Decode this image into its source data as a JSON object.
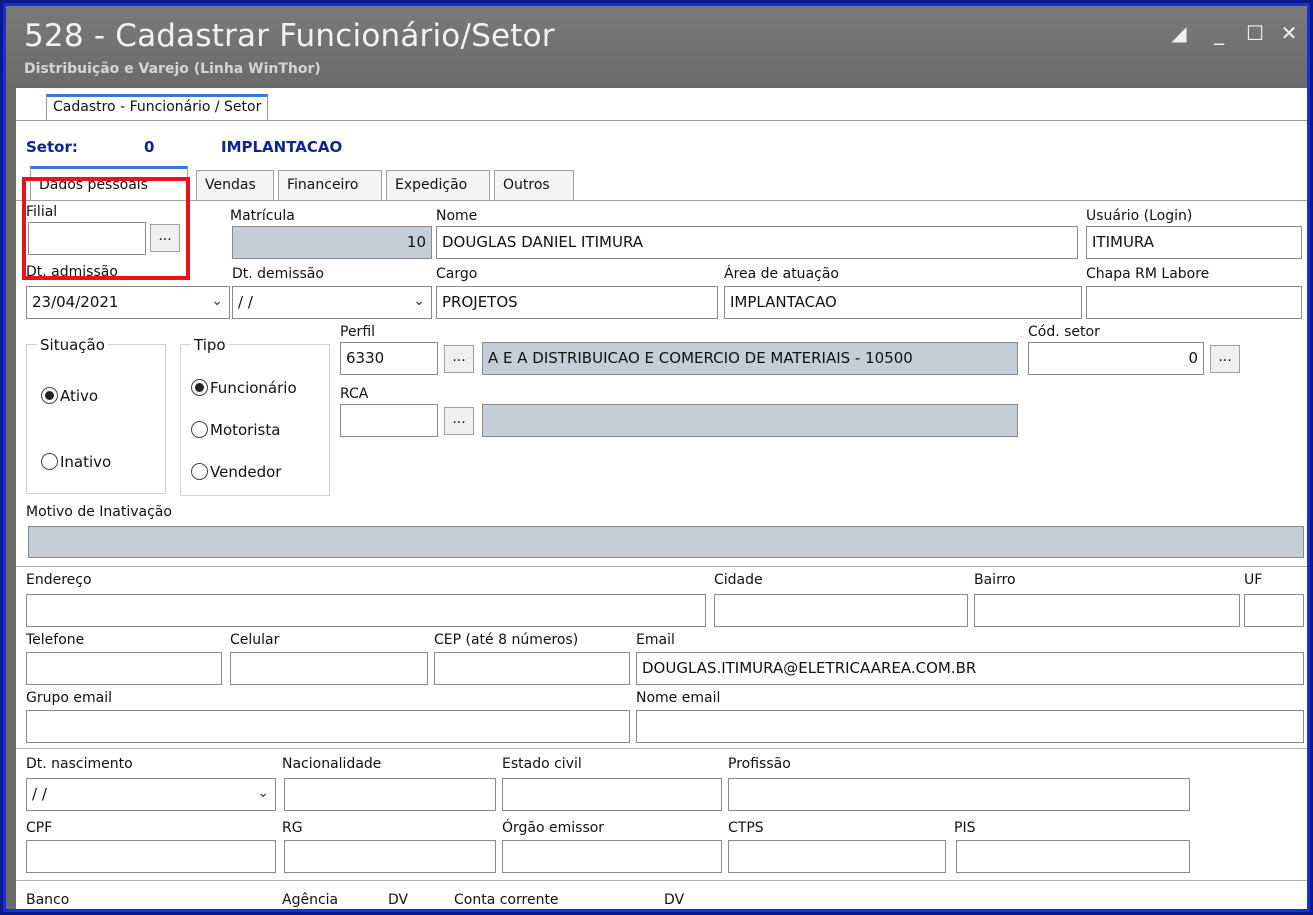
{
  "window": {
    "title": "528 - Cadastrar Funcionário/Setor",
    "subtitle": "Distribuição e Varejo (Linha WinThor)"
  },
  "main_tab": "Cadastro - Funcionário / Setor",
  "setor": {
    "label": "Setor:",
    "code": "0",
    "name": "IMPLANTACAO"
  },
  "tabs": [
    "Dados pessoais",
    "Vendas",
    "Financeiro",
    "Expedição",
    "Outros"
  ],
  "form": {
    "filial": {
      "label": "Filial",
      "value": ""
    },
    "matricula": {
      "label": "Matrícula",
      "value": "10"
    },
    "nome": {
      "label": "Nome",
      "value": "DOUGLAS DANIEL ITIMURA"
    },
    "usuario": {
      "label": "Usuário (Login)",
      "value": "ITIMURA"
    },
    "dt_admissao": {
      "label": "Dt. admissão",
      "value": "23/04/2021"
    },
    "dt_demissao": {
      "label": "Dt.  demissão",
      "value": "/ /"
    },
    "cargo": {
      "label": "Cargo",
      "value": "PROJETOS"
    },
    "area": {
      "label": "Área de atuação",
      "value": "IMPLANTACAO"
    },
    "chapa": {
      "label": "Chapa RM Labore",
      "value": ""
    },
    "situacao": {
      "label": "Situação",
      "options": [
        "Ativo",
        "Inativo"
      ],
      "selected": "Ativo"
    },
    "tipo": {
      "label": "Tipo",
      "options": [
        "Funcionário",
        "Motorista",
        "Vendedor"
      ],
      "selected": "Funcionário"
    },
    "perfil": {
      "label": "Perfil",
      "code": "6330",
      "desc": "A E A DISTRIBUICAO E COMERCIO DE MATERIAIS - 10500"
    },
    "cod_setor": {
      "label": "Cód. setor",
      "value": "0"
    },
    "rca": {
      "label": "RCA",
      "code": "",
      "desc": ""
    },
    "motivo_inativacao": {
      "label": "Motivo de Inativação",
      "value": ""
    },
    "endereco": {
      "label": "Endereço",
      "value": ""
    },
    "cidade": {
      "label": "Cidade",
      "value": ""
    },
    "bairro": {
      "label": "Bairro",
      "value": ""
    },
    "uf": {
      "label": "UF",
      "value": ""
    },
    "telefone": {
      "label": "Telefone",
      "value": ""
    },
    "celular": {
      "label": "Celular",
      "value": ""
    },
    "cep": {
      "label": "CEP (até 8 números)",
      "value": ""
    },
    "email": {
      "label": "Email",
      "value": "DOUGLAS.ITIMURA@ELETRICAAREA.COM.BR"
    },
    "grupo_email": {
      "label": "Grupo email",
      "value": ""
    },
    "nome_email": {
      "label": "Nome email",
      "value": ""
    },
    "dt_nascimento": {
      "label": "Dt. nascimento",
      "value": "/ /"
    },
    "nacionalidade": {
      "label": "Nacionalidade",
      "value": ""
    },
    "estado_civil": {
      "label": "Estado civil",
      "value": ""
    },
    "profissao": {
      "label": "Profissão",
      "value": ""
    },
    "cpf": {
      "label": "CPF",
      "value": ""
    },
    "rg": {
      "label": "RG",
      "value": ""
    },
    "orgao_emissor": {
      "label": "Órgão emissor",
      "value": ""
    },
    "ctps": {
      "label": "CTPS",
      "value": ""
    },
    "pis": {
      "label": "PIS",
      "value": ""
    },
    "banco": {
      "label": "Banco"
    },
    "agencia": {
      "label": "Agência"
    },
    "dv1": {
      "label": "DV"
    },
    "conta_corrente": {
      "label": "Conta corrente"
    },
    "dv2": {
      "label": "DV"
    }
  },
  "dots_label": "...",
  "colors": {
    "highlight": "#e8141c",
    "accent": "#3b78d8",
    "setor_text": "#0e2590"
  }
}
